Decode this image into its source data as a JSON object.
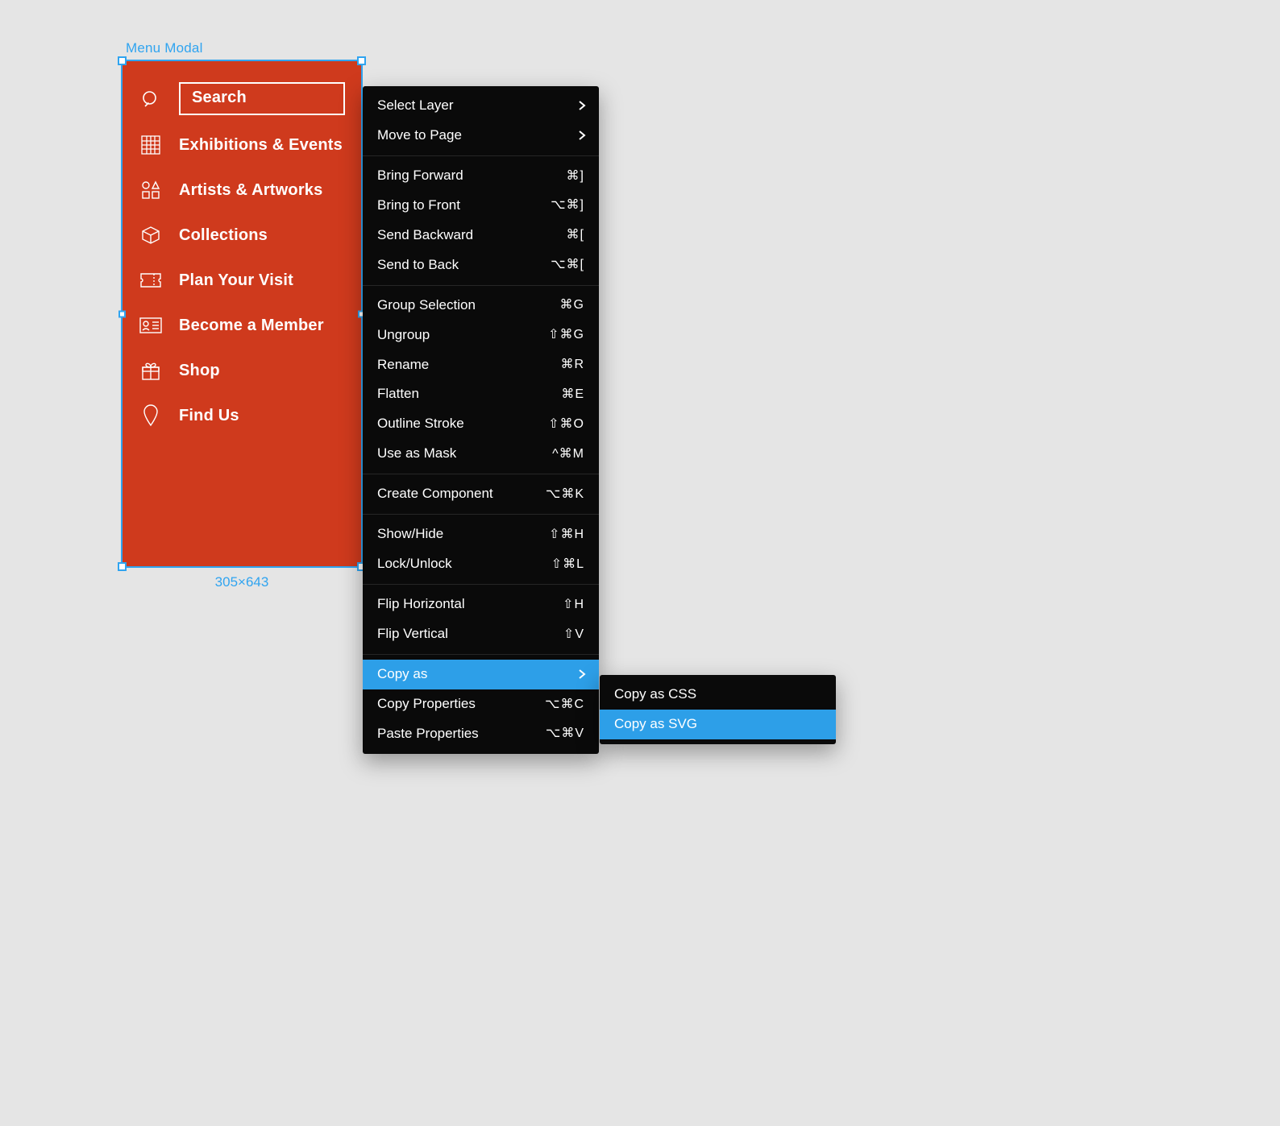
{
  "frame": {
    "label": "Menu Modal",
    "dimensions": "305×643",
    "items": [
      {
        "label": "Search",
        "icon": "search"
      },
      {
        "label": "Exhibitions & Events",
        "icon": "calendar"
      },
      {
        "label": "Artists & Artworks",
        "icon": "shapes"
      },
      {
        "label": "Collections",
        "icon": "cube"
      },
      {
        "label": "Plan Your Visit",
        "icon": "ticket"
      },
      {
        "label": "Become a Member",
        "icon": "idcard"
      },
      {
        "label": "Shop",
        "icon": "gift"
      },
      {
        "label": "Find Us",
        "icon": "pin"
      }
    ]
  },
  "context_menu": {
    "sections": [
      [
        {
          "label": "Select Layer",
          "arrow": true
        },
        {
          "label": "Move to Page",
          "arrow": true
        }
      ],
      [
        {
          "label": "Bring Forward",
          "shortcut": "⌘]"
        },
        {
          "label": "Bring to Front",
          "shortcut": "⌥⌘]"
        },
        {
          "label": "Send Backward",
          "shortcut": "⌘["
        },
        {
          "label": "Send to Back",
          "shortcut": "⌥⌘["
        }
      ],
      [
        {
          "label": "Group Selection",
          "shortcut": "⌘G"
        },
        {
          "label": "Ungroup",
          "shortcut": "⇧⌘G"
        },
        {
          "label": "Rename",
          "shortcut": "⌘R"
        },
        {
          "label": "Flatten",
          "shortcut": "⌘E"
        },
        {
          "label": "Outline Stroke",
          "shortcut": "⇧⌘O"
        },
        {
          "label": "Use as Mask",
          "shortcut": "^⌘M"
        }
      ],
      [
        {
          "label": "Create Component",
          "shortcut": "⌥⌘K"
        }
      ],
      [
        {
          "label": "Show/Hide",
          "shortcut": "⇧⌘H"
        },
        {
          "label": "Lock/Unlock",
          "shortcut": "⇧⌘L"
        }
      ],
      [
        {
          "label": "Flip Horizontal",
          "shortcut": "⇧H"
        },
        {
          "label": "Flip Vertical",
          "shortcut": "⇧V"
        }
      ],
      [
        {
          "label": "Copy as",
          "arrow": true,
          "highlight": true
        },
        {
          "label": "Copy Properties",
          "shortcut": "⌥⌘C"
        },
        {
          "label": "Paste Properties",
          "shortcut": "⌥⌘V"
        }
      ]
    ]
  },
  "submenu": {
    "items": [
      {
        "label": "Copy as CSS"
      },
      {
        "label": "Copy as SVG",
        "highlight": true
      }
    ]
  }
}
